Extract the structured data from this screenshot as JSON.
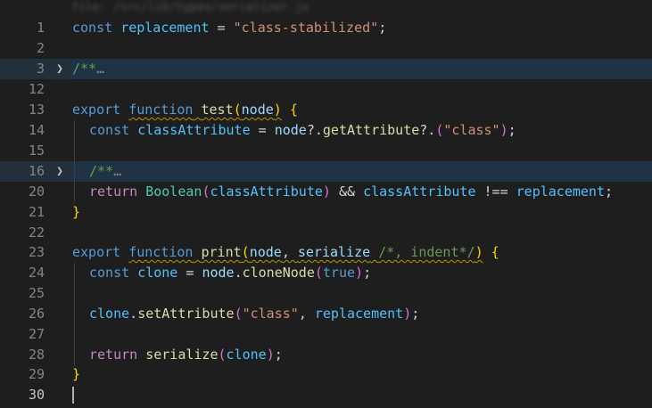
{
  "editor": {
    "breadcrumb_blurred": "file: /src/lib/types/serializer.js",
    "fold_chevron": "chevron-right-icon",
    "fold_placeholder": "…",
    "lines": [
      {
        "number": "1",
        "tokens": [
          "const",
          " ",
          "replacement",
          " = ",
          "\"class-stabilized\"",
          ";"
        ]
      },
      {
        "number": "2"
      },
      {
        "number": "3",
        "folded": true,
        "tokens": [
          "/**"
        ]
      },
      {
        "number": "12"
      },
      {
        "number": "13",
        "tokens": [
          "export",
          " ",
          "function",
          " ",
          "test",
          "(",
          "node",
          ")",
          " ",
          "{"
        ]
      },
      {
        "number": "14",
        "tokens": [
          "const",
          " ",
          "classAttribute",
          " = ",
          "node",
          "?.",
          "getAttribute",
          "?.",
          "(",
          "\"class\"",
          ")",
          ";"
        ]
      },
      {
        "number": "15"
      },
      {
        "number": "16",
        "folded": true,
        "tokens": [
          "/**"
        ]
      },
      {
        "number": "20",
        "tokens": [
          "return",
          " ",
          "Boolean",
          "(",
          "classAttribute",
          ")",
          " && ",
          "classAttribute",
          " !== ",
          "replacement",
          ";"
        ]
      },
      {
        "number": "21",
        "tokens": [
          "}"
        ]
      },
      {
        "number": "22"
      },
      {
        "number": "23",
        "tokens": [
          "export",
          " ",
          "function",
          " ",
          "print",
          "(",
          "node",
          ", ",
          "serialize",
          " ",
          "/*, indent*/",
          ")",
          " ",
          "{"
        ]
      },
      {
        "number": "24",
        "tokens": [
          "const",
          " ",
          "clone",
          " = ",
          "node",
          ".",
          "cloneNode",
          "(",
          "true",
          ")",
          ";"
        ]
      },
      {
        "number": "25"
      },
      {
        "number": "26",
        "tokens": [
          "clone",
          ".",
          "setAttribute",
          "(",
          "\"class\"",
          ", ",
          "replacement",
          ")",
          ";"
        ]
      },
      {
        "number": "27"
      },
      {
        "number": "28",
        "tokens": [
          "return",
          " ",
          "serialize",
          "(",
          "clone",
          ")",
          ";"
        ]
      },
      {
        "number": "29",
        "tokens": [
          "}"
        ]
      },
      {
        "number": "30",
        "active": true
      }
    ]
  },
  "colors": {
    "background": "#1e1e1e",
    "keyword": "#569cd6",
    "control": "#c586c0",
    "variable": "#9cdcfe",
    "constant": "#4fc1ff",
    "string": "#ce9178",
    "function": "#dcdcaa",
    "type": "#4ec9b0",
    "comment": "#6a9955",
    "bracket_level1": "#ffd700",
    "bracket_level2": "#da70d6",
    "warning_squiggle": "#b89500"
  }
}
